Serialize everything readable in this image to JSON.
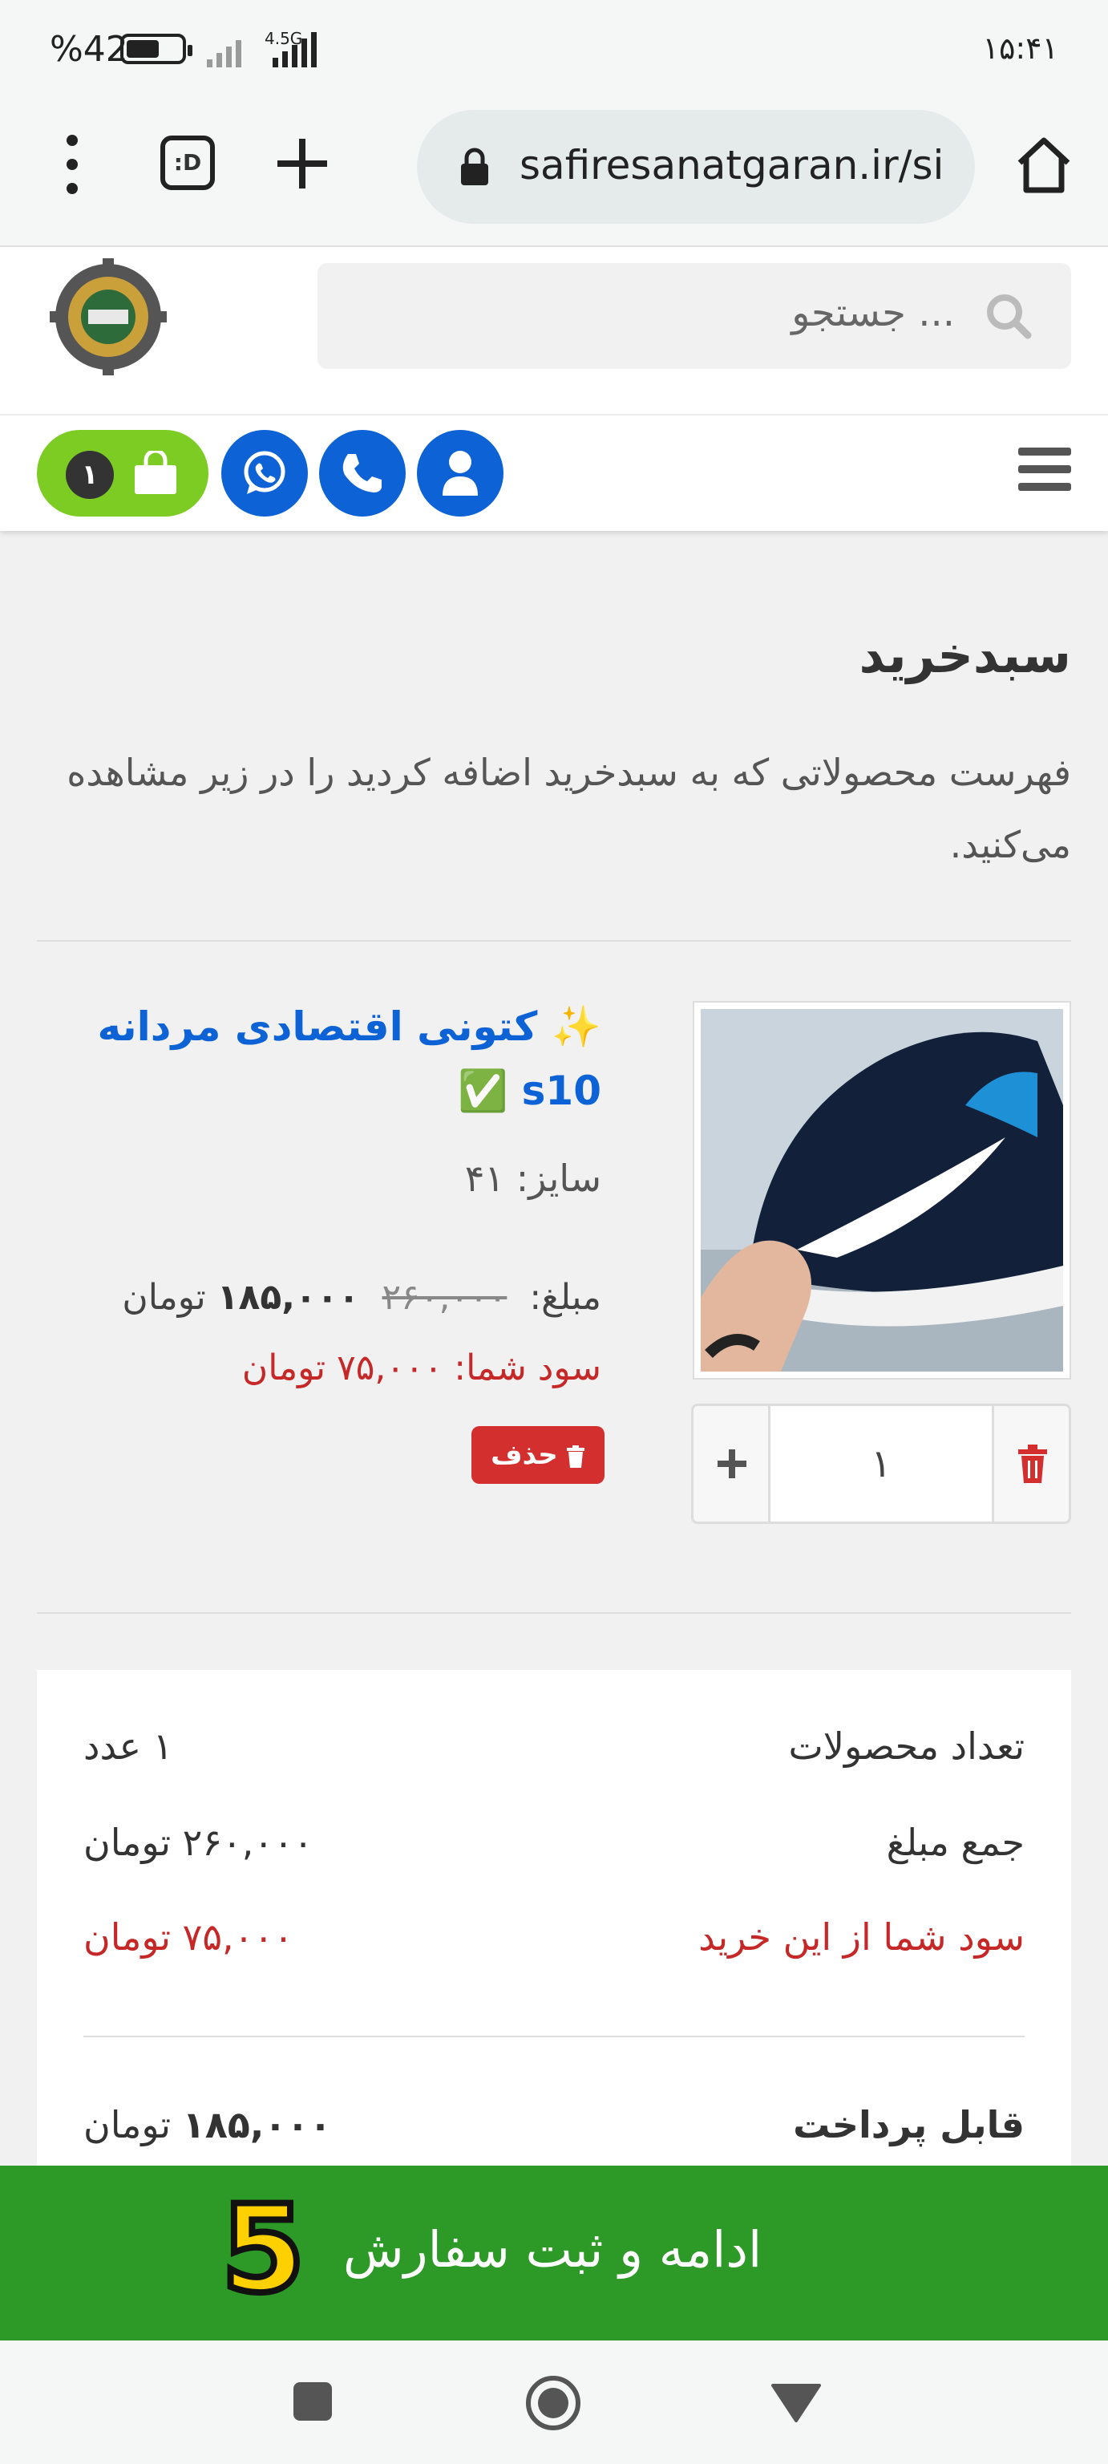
{
  "status_bar": {
    "time": "۱۵:۴۱",
    "battery": "%42",
    "network": "4.5G"
  },
  "browser": {
    "url": "safiresanatgaran.ir/si",
    "tabs_label": ":D"
  },
  "site": {
    "search_placeholder": "جستجو ...",
    "cart_count": "۱"
  },
  "page": {
    "title": "سبدخرید",
    "subtitle": "فهرست محصولاتی که به سبدخرید اضافه کردید را در زیر مشاهده می‌کنید."
  },
  "item": {
    "name": "✨ کتونی اقتصادی مردانه s10 ✅",
    "size": "سایز: ۴۱",
    "price_label": "مبلغ:",
    "old_price": "۲۶۰,۰۰۰",
    "new_price": "۱۸۵,۰۰۰",
    "currency": "تومان",
    "profit": "سود شما: ۷۵,۰۰۰ تومان",
    "delete_label": "حذف",
    "quantity": "۱"
  },
  "summary": {
    "count_label": "تعداد محصولات",
    "count_value": "۱ عدد",
    "total_label": "جمع مبلغ",
    "total_value": "۲۶۰,۰۰۰ تومان",
    "profit_label": "سود شما از این خرید",
    "profit_value": "۷۵,۰۰۰ تومان",
    "payable_label": "قابل پرداخت",
    "payable_amount": "۱۸۵,۰۰۰",
    "payable_currency": "تومان"
  },
  "cta": {
    "label": "ادامه و ثبت سفارش",
    "badge": "5"
  },
  "colors": {
    "primary_blue": "#0d62d6",
    "cart_green": "#7ccc24",
    "cta_green": "#2d9a27",
    "danger_red": "#d32f2f",
    "profit_red": "#c62828"
  }
}
